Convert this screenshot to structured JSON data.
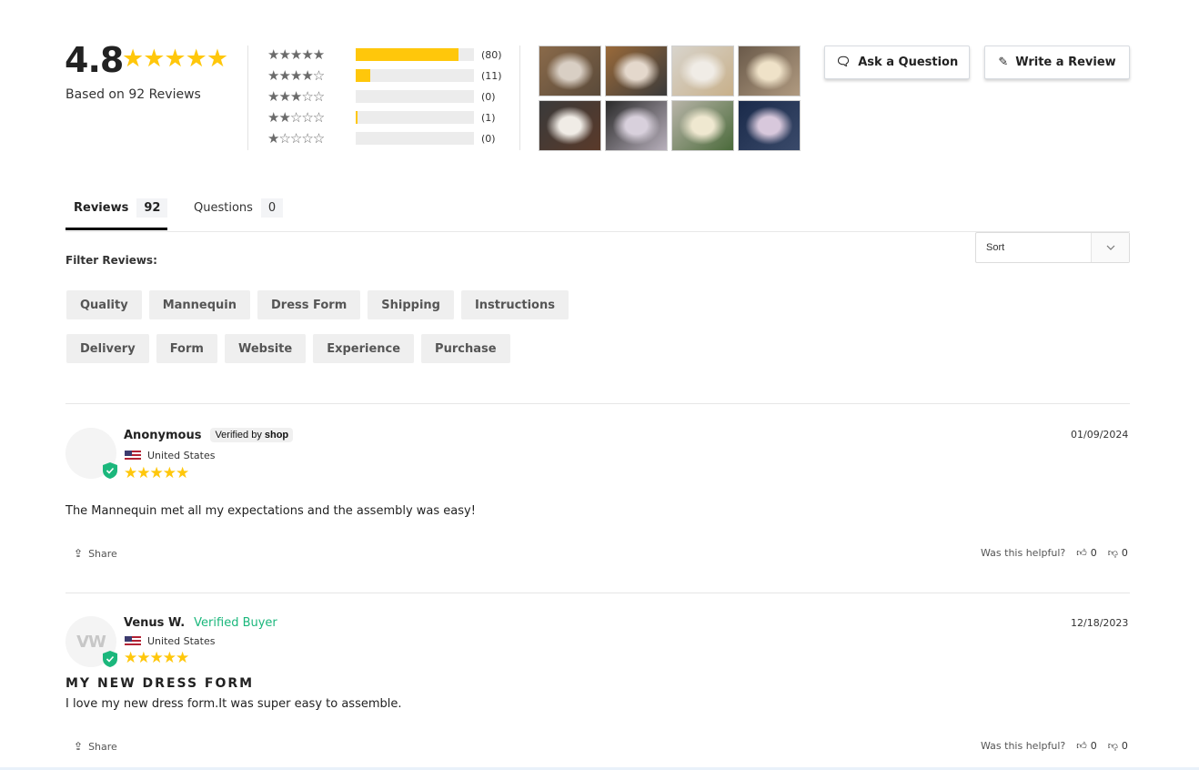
{
  "summary": {
    "average": "4.8",
    "average_stars": "★★★★★",
    "based_on": "Based on 92 Reviews",
    "histogram": [
      {
        "stars": "★★★★★",
        "label": "5 stars",
        "count_label": "(80)",
        "count": 80,
        "fraction": 0.87
      },
      {
        "stars": "★★★★☆",
        "label": "4 stars",
        "count_label": "(11)",
        "count": 11,
        "fraction": 0.12
      },
      {
        "stars": "★★★☆☆",
        "label": "3 stars",
        "count_label": "(0)",
        "count": 0,
        "fraction": 0
      },
      {
        "stars": "★★☆☆☆",
        "label": "2 stars",
        "count_label": "(1)",
        "count": 1,
        "fraction": 0.01
      },
      {
        "stars": "★☆☆☆☆",
        "label": "1 star",
        "count_label": "(0)",
        "count": 0,
        "fraction": 0
      }
    ],
    "photos": [
      {
        "colors": [
          "#8a6a4a",
          "#d9cfc4",
          "#5a4a3a"
        ]
      },
      {
        "colors": [
          "#9a6a3a",
          "#e4d8cc",
          "#3a3a3a"
        ]
      },
      {
        "colors": [
          "#d8d4cc",
          "#f0ece6",
          "#c8b08a"
        ]
      },
      {
        "colors": [
          "#6a5a4a",
          "#efe2c8",
          "#b09a80"
        ]
      },
      {
        "colors": [
          "#3a3a3a",
          "#f0ece6",
          "#5a3a2a"
        ]
      },
      {
        "colors": [
          "#2a2a2a",
          "#d8d0dc",
          "#b8b0bc"
        ]
      },
      {
        "colors": [
          "#b8b4a8",
          "#efe8d0",
          "#4a6a3a"
        ]
      },
      {
        "colors": [
          "#1a2a4a",
          "#d8c8dc",
          "#3a4a6a"
        ]
      }
    ]
  },
  "actions": {
    "ask_question": "Ask a Question",
    "ask_icon": "comments-icon",
    "write_review": "Write a Review",
    "write_icon": "edit-icon"
  },
  "tabs": [
    {
      "label": "Reviews",
      "count": "92",
      "active": true
    },
    {
      "label": "Questions",
      "count": "0",
      "active": false
    }
  ],
  "filter": {
    "title": "Filter Reviews:",
    "chips": [
      "Quality",
      "Mannequin",
      "Dress Form",
      "Shipping",
      "Instructions",
      "Delivery",
      "Form",
      "Website",
      "Experience",
      "Purchase"
    ]
  },
  "sort": {
    "selected": "Sort",
    "arrow": "⌄"
  },
  "reviews": [
    {
      "name": "Anonymous",
      "badge_prefix": "Verified by ",
      "badge_brand": "shop",
      "initials": "",
      "country": "United States",
      "stars": "★★★★★",
      "rating": 5,
      "date": "01/09/2024",
      "title": "",
      "body": "The Mannequin met all my expectations and the assembly was easy!",
      "share": "Share",
      "helpful_label": "Was this helpful?",
      "up": "0",
      "down": "0"
    },
    {
      "name": "Venus W.",
      "badge": "Verified Buyer",
      "initials": "VW",
      "country": "United States",
      "stars": "★★★★★",
      "rating": 5,
      "date": "12/18/2023",
      "title": "MY NEW DRESS FORM",
      "body": "I love my new dress form.It was super easy to assemble.",
      "share": "Share",
      "helpful_label": "Was this helpful?",
      "up": "0",
      "down": "0"
    }
  ],
  "colors": {
    "star": "#ffc70b",
    "verified_green": "#1bb77c",
    "bar_bg": "#ececec"
  }
}
